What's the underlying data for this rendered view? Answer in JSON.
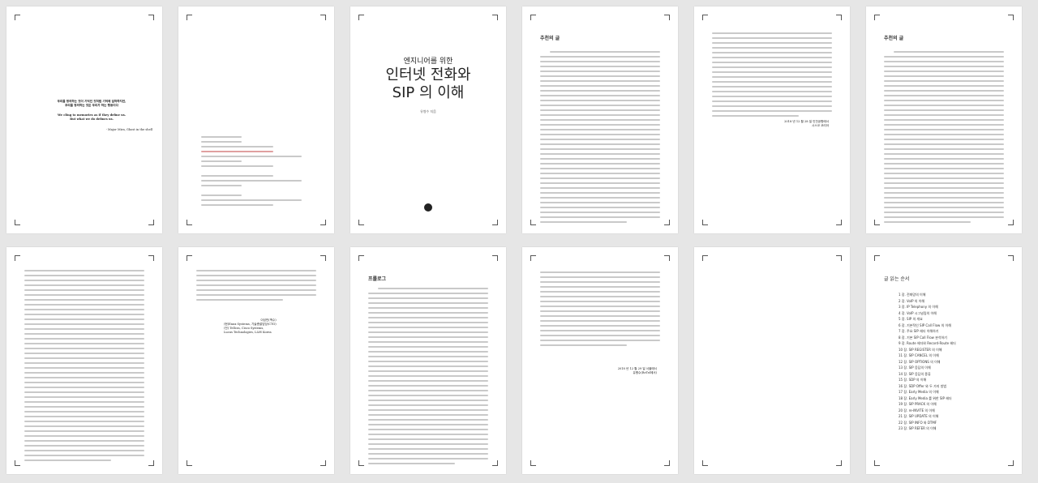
{
  "pages": {
    "p1": {
      "epigraph_ko_1": "우리를 정의하는 것이 기억인 것처럼 기억에 집착하지만,",
      "epigraph_ko_2": "우리를 정의하는 것은 우리가 하는 행동이다",
      "epigraph_en_1": "We cling to memories as if they define us.",
      "epigraph_en_2": "But what we do defines us.",
      "epigraph_attr": "- Major Mira, Ghost in the shell"
    },
    "p3": {
      "subtitle": "엔지니어를 위한",
      "title_line1": "인터넷 전화와",
      "title_line2": "SIP 의 이해",
      "author": "유병수 지음"
    },
    "p4": {
      "heading": "추천의 글"
    },
    "p5": {
      "sign_date": "2018 년 12 월 28 일 인천공항에서",
      "sign_name": "시스코 코리아"
    },
    "p6": {
      "heading": "추천의 글"
    },
    "p8": {
      "sign_1": "이성민(백수)",
      "sign_2": "(현)Enux Systems, 기술총괄담당(CTO)",
      "sign_3": "(전) Tellcra, Cisco Systems,",
      "sign_4": "Lucus Technologies, L&H Korea"
    },
    "p9": {
      "heading": "프롤로그"
    },
    "p10": {
      "sign_date": "2018 년 12 월 29 일 서울에서",
      "sign_name": "유병수(ReTel에서)"
    },
    "p12": {
      "heading": "글 읽는 순서",
      "toc": [
        "1 장. 전화망의 이해",
        "2 장. VoIP 의 이해",
        "3 장. IP Telephony 의 이해",
        "4 장. VoIP 시그널링의 이해",
        "5 장. SIP 의 개요",
        "6 장. 기본적인 SIP Call Flow 의 이해",
        "7 장. 주요 SIP 헤더 이해하기",
        "8 장. 기본 SIP Call Flow 분석하기",
        "9 장. Route 헤더와 Record-Route 헤더",
        "10 장. SIP REGISTER 의 이해",
        "11 장. SIP CANCEL 의 이해",
        "12 장. SIP OPTIONS 의 이해",
        "13 장. SIP 응답의 이해",
        "14 장. SIP 응답의 종류",
        "15 장. SDP 의 이해",
        "16 장. SDP Offer 와 두 가지 방법",
        "17 장. Early Media 의 이해",
        "18 장. Early Media 를 위한 SIP 헤더",
        "19 장. SIP PRACK 의 이해",
        "20 장. re-INVITE 의 이해",
        "21 장. SIP UPDATE 의 이해",
        "22 장. SIP INFO 와 DTMF",
        "23 장. SIP REFER 의 이해"
      ]
    }
  },
  "colors": {
    "background": "#e6e6e6",
    "page": "#ffffff",
    "text_line": "#c9c9c9",
    "spellcheck": "#cc0000"
  }
}
